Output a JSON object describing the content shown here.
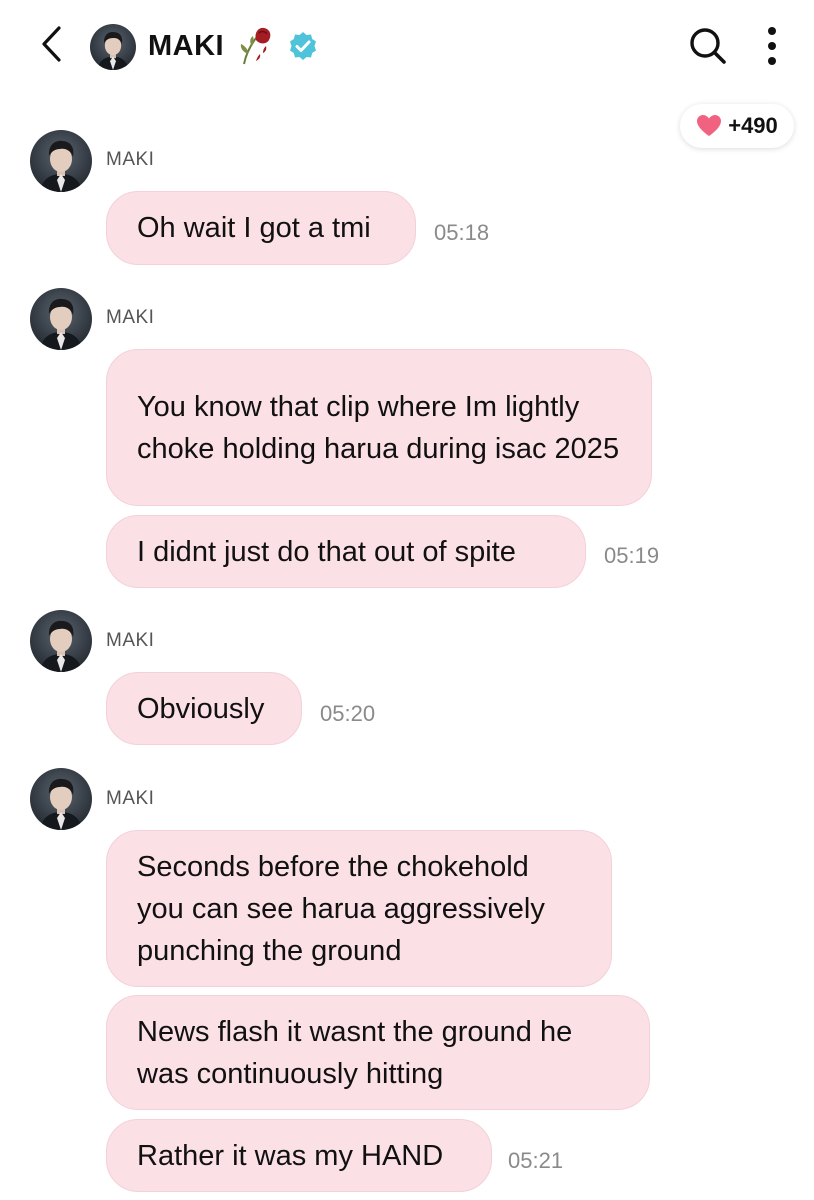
{
  "header": {
    "contact_name": "MAKI",
    "icons": [
      "back-icon",
      "avatar",
      "wilted-rose-icon",
      "verified-badge-icon",
      "search-icon",
      "more-vertical-icon"
    ]
  },
  "like_badge": {
    "count": "+490",
    "icon": "heart-icon",
    "color": "#f0627f"
  },
  "colors": {
    "bubble": "#fbe0e6",
    "bubble_border": "#f3d1d9",
    "verified": "#4fc3d9"
  },
  "messages": [
    {
      "sender": "MAKI",
      "bubbles": [
        "Oh wait I got a tmi"
      ],
      "time": "05:18"
    },
    {
      "sender": "MAKI",
      "bubbles": [
        "You know that clip where Im lightly choke holding harua during isac 2025",
        "I didnt just do that out of spite"
      ],
      "time": "05:19"
    },
    {
      "sender": "MAKI",
      "bubbles": [
        "Obviously"
      ],
      "time": "05:20"
    },
    {
      "sender": "MAKI",
      "bubbles": [
        "Seconds before the chokehold you can see harua aggressively punching the ground",
        "News flash it wasnt the ground he was continuously hitting",
        "Rather it was my HAND"
      ],
      "time": "05:21"
    }
  ]
}
